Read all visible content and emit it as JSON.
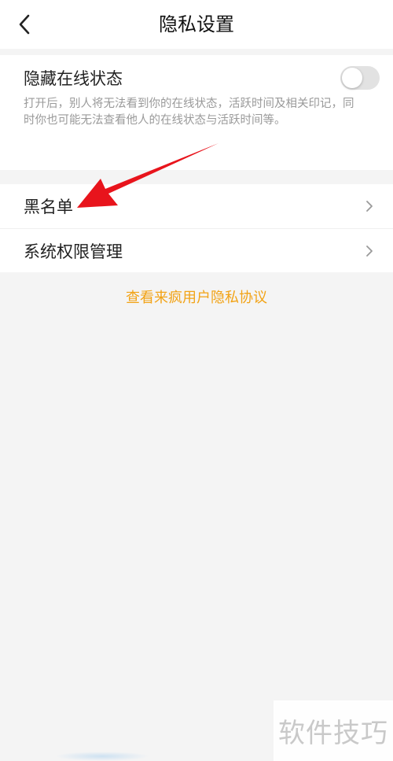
{
  "header": {
    "title": "隐私设置"
  },
  "online_status": {
    "title": "隐藏在线状态",
    "description": "打开后，别人将无法看到你的在线状态，活跃时间及相关印记，同时你也可能无法查看他人的在线状态与活跃时间等。",
    "enabled": false
  },
  "menu": {
    "items": [
      {
        "label": "黑名单"
      },
      {
        "label": "系统权限管理"
      }
    ]
  },
  "policy_link": "查看来疯用户隐私协议",
  "watermark": "软件技巧",
  "colors": {
    "accent": "#f2a316",
    "annotation_arrow": "#e8141c",
    "background": "#f4f4f4",
    "toggle_off": "#e2e2e2"
  }
}
